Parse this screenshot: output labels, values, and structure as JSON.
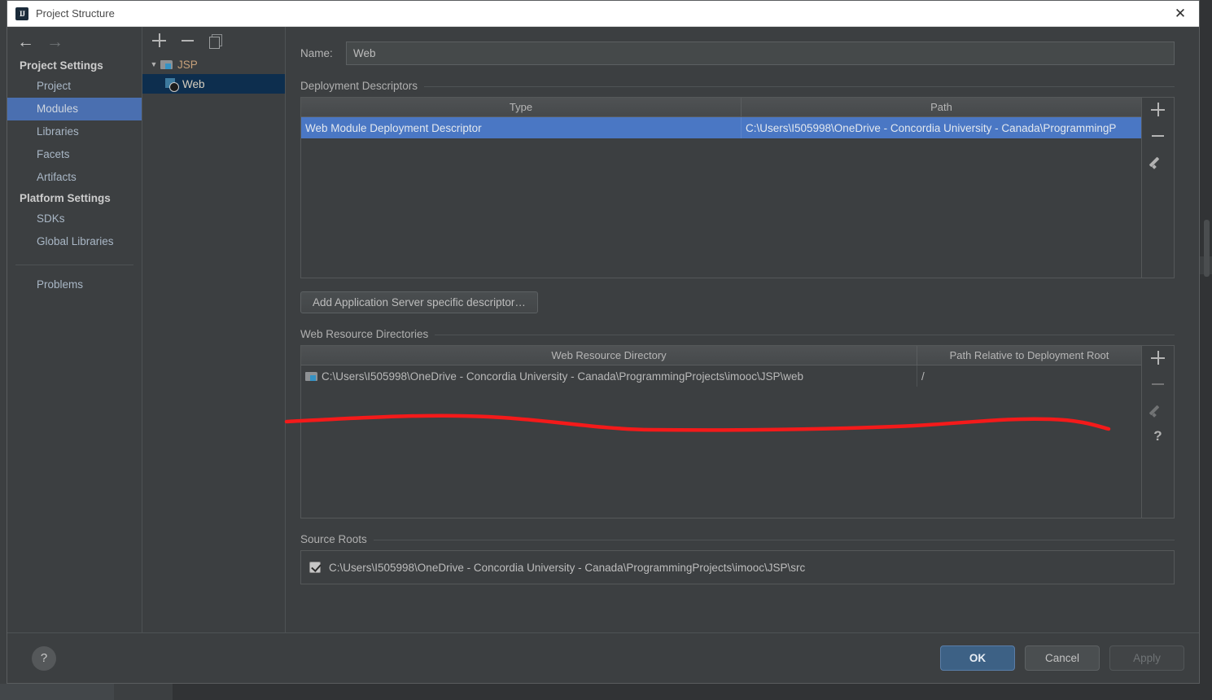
{
  "window": {
    "title": "Project Structure",
    "app_icon": "intellij-idea-icon",
    "close_label": "✕"
  },
  "nav": {
    "back_icon": "arrow-left-icon",
    "forward_icon": "arrow-right-icon",
    "back_glyph": "←",
    "forward_glyph": "→"
  },
  "sidebar": {
    "groups": [
      {
        "title": "Project Settings",
        "items": [
          {
            "label": "Project",
            "selected": false
          },
          {
            "label": "Modules",
            "selected": true
          },
          {
            "label": "Libraries",
            "selected": false
          },
          {
            "label": "Facets",
            "selected": false
          },
          {
            "label": "Artifacts",
            "selected": false
          }
        ]
      },
      {
        "title": "Platform Settings",
        "items": [
          {
            "label": "SDKs",
            "selected": false
          },
          {
            "label": "Global Libraries",
            "selected": false
          }
        ]
      }
    ],
    "problems": {
      "label": "Problems",
      "selected": false
    }
  },
  "tree_panel": {
    "toolbar": [
      {
        "name": "add-module-button",
        "icon": "plus-icon"
      },
      {
        "name": "remove-module-button",
        "icon": "minus-icon"
      },
      {
        "name": "copy-module-button",
        "icon": "copy-icon"
      }
    ],
    "nodes": [
      {
        "label": "JSP",
        "icon": "module-folder-icon",
        "expanded": true,
        "arrow": "▼",
        "selected": false,
        "indent": 0
      },
      {
        "label": "Web",
        "icon": "web-facet-icon",
        "expanded": false,
        "arrow": "",
        "selected": true,
        "indent": 1
      }
    ]
  },
  "content": {
    "name_label": "Name:",
    "name_value": "Web",
    "name_placeholder": "",
    "deployment_descriptors": {
      "title": "Deployment Descriptors",
      "columns": [
        "Type",
        "Path"
      ],
      "rows": [
        {
          "type": "Web Module Deployment Descriptor",
          "path": "C:\\Users\\I505998\\OneDrive - Concordia University - Canada\\ProgrammingP",
          "selected": true
        }
      ],
      "toolbar": [
        {
          "name": "add-descriptor-icon-button",
          "icon": "plus-icon",
          "enabled": true
        },
        {
          "name": "remove-descriptor-button",
          "icon": "minus-icon",
          "enabled": true
        },
        {
          "name": "edit-descriptor-button",
          "icon": "pencil-icon",
          "enabled": true
        }
      ],
      "add_button_label": "Add Application Server specific descriptor…"
    },
    "web_resource_directories": {
      "title": "Web Resource Directories",
      "columns": [
        "Web Resource Directory",
        "Path Relative to Deployment Root"
      ],
      "rows": [
        {
          "directory": "C:\\Users\\I505998\\OneDrive - Concordia University - Canada\\ProgrammingProjects\\imooc\\JSP\\web",
          "relative_path": "/",
          "icon": "folder-link-icon",
          "selected": false
        }
      ],
      "toolbar": [
        {
          "name": "add-web-resource-button",
          "icon": "plus-icon",
          "enabled": true
        },
        {
          "name": "remove-web-resource-button",
          "icon": "minus-icon",
          "enabled": false
        },
        {
          "name": "edit-web-resource-button",
          "icon": "pencil-icon",
          "enabled": false
        },
        {
          "name": "web-resource-help-button",
          "icon": "question-icon",
          "enabled": true
        }
      ]
    },
    "source_roots": {
      "title": "Source Roots",
      "items": [
        {
          "path": "C:\\Users\\I505998\\OneDrive - Concordia University - Canada\\ProgrammingProjects\\imooc\\JSP\\src",
          "checked": true
        }
      ]
    }
  },
  "footer": {
    "help_icon": "question-icon",
    "help_glyph": "?",
    "ok_label": "OK",
    "cancel_label": "Cancel",
    "apply_label": "Apply",
    "apply_enabled": false
  },
  "annotation": {
    "type": "freehand-red-underline",
    "color": "#f41a1a"
  },
  "colors": {
    "dialog_bg": "#3c3f41",
    "selection_blue": "#4a77c4",
    "sidebar_selection": "#4a6fb0",
    "tree_selection": "#0d2e4e",
    "accent_primary": "#3d6185",
    "text": "#bdbdbd",
    "tree_text": "#c7a17a",
    "annotation_red": "#f41a1a"
  }
}
